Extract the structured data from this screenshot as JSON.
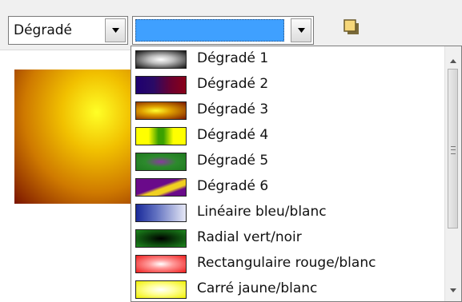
{
  "toolbar": {
    "fill_type": {
      "value": "Dégradé"
    },
    "gradient_combo": {
      "selected_color": "#3fa0ff"
    },
    "area_tool": {
      "icon": "fill-area-icon"
    }
  },
  "preview": {
    "colors": [
      "#ffff26",
      "#f1c000",
      "#cf7a00",
      "#7a1400"
    ]
  },
  "gradient_list": {
    "items": [
      {
        "label": "Dégradé 1"
      },
      {
        "label": "Dégradé 2"
      },
      {
        "label": "Dégradé 3"
      },
      {
        "label": "Dégradé 4"
      },
      {
        "label": "Dégradé 5"
      },
      {
        "label": "Dégradé 6"
      },
      {
        "label": "Linéaire bleu/blanc"
      },
      {
        "label": "Radial vert/noir"
      },
      {
        "label": "Rectangulaire rouge/blanc"
      },
      {
        "label": "Carré jaune/blanc"
      }
    ]
  }
}
